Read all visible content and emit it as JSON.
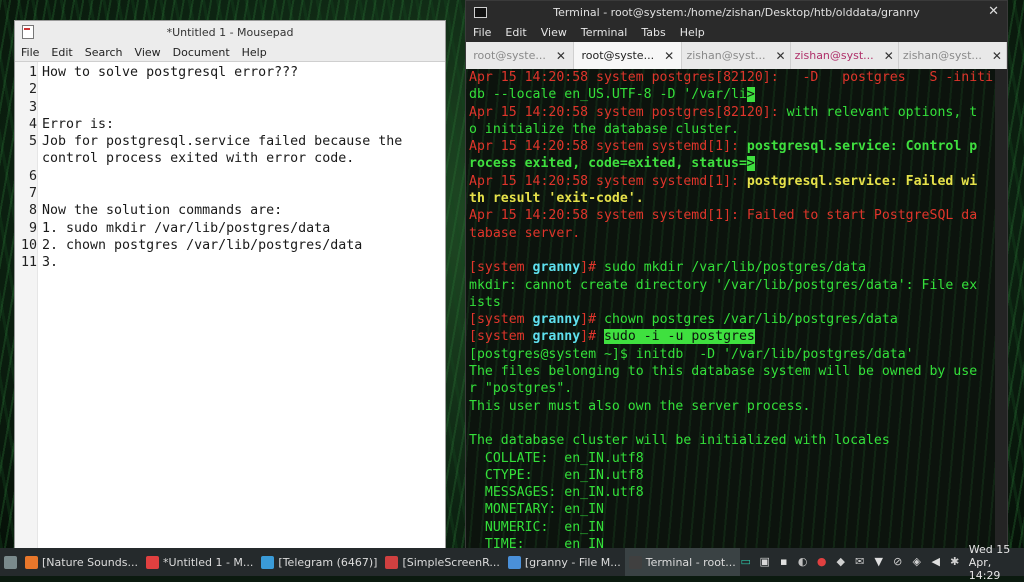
{
  "mousepad": {
    "title": "*Untitled 1 - Mousepad",
    "menu": [
      "File",
      "Edit",
      "Search",
      "View",
      "Document",
      "Help"
    ],
    "lines": [
      {
        "n": "1",
        "t": "How to solve postgresql error???"
      },
      {
        "n": "2",
        "t": ""
      },
      {
        "n": "3",
        "t": ""
      },
      {
        "n": "4",
        "t": "Error is:"
      },
      {
        "n": "5",
        "t": "Job for postgresql.service failed because the"
      },
      {
        "n": "",
        "t": "control process exited with error code."
      },
      {
        "n": "6",
        "t": ""
      },
      {
        "n": "7",
        "t": ""
      },
      {
        "n": "8",
        "t": "Now the solution commands are:"
      },
      {
        "n": "9",
        "t": "1. sudo mkdir /var/lib/postgres/data"
      },
      {
        "n": "10",
        "t": "2. chown postgres /var/lib/postgres/data"
      },
      {
        "n": "11",
        "t": "3."
      }
    ]
  },
  "terminal": {
    "title": "Terminal - root@system:/home/zishan/Desktop/htb/olddata/granny",
    "close": "✕",
    "menu": [
      "File",
      "Edit",
      "View",
      "Terminal",
      "Tabs",
      "Help"
    ],
    "tabs": [
      {
        "label": "root@syste...",
        "state": "normal"
      },
      {
        "label": "root@syste...",
        "state": "active"
      },
      {
        "label": "zishan@syst...",
        "state": "normal"
      },
      {
        "label": "zishan@syst...",
        "state": "alert"
      },
      {
        "label": "zishan@syst...",
        "state": "normal"
      }
    ],
    "tab_close": "✕",
    "lines": [
      [
        {
          "c": "c-red",
          "t": "Apr 15 14:20:58 system postgres[82120]:   -D   postgres   S -initi"
        }
      ],
      [
        {
          "c": "c-green",
          "t": "db --locale en_US.UTF-8 -D '/var/li"
        },
        {
          "c": "curs",
          "t": ">"
        }
      ],
      [
        {
          "c": "c-red",
          "t": "Apr 15 14:20:58 system postgres[82120]: "
        },
        {
          "c": "c-green",
          "t": "with relevant options, t"
        }
      ],
      [
        {
          "c": "c-green",
          "t": "o initialize the database cluster."
        }
      ],
      [
        {
          "c": "c-red",
          "t": "Apr 15 14:20:58 system systemd[1]: "
        },
        {
          "c": "c-bgreen",
          "t": "postgresql.service: Control p"
        }
      ],
      [
        {
          "c": "c-bgreen",
          "t": "rocess exited, code=exited, status="
        },
        {
          "c": "curs",
          "t": ">"
        }
      ],
      [
        {
          "c": "c-red",
          "t": "Apr 15 14:20:58 system systemd[1]: "
        },
        {
          "c": "c-yellow",
          "t": "postgresql.service: Failed wi"
        }
      ],
      [
        {
          "c": "c-yellow",
          "t": "th result 'exit-code'."
        }
      ],
      [
        {
          "c": "c-red",
          "t": "Apr 15 14:20:58 system systemd[1]: "
        },
        {
          "c": "c-red",
          "t": "Failed to start PostgreSQL da"
        }
      ],
      [
        {
          "c": "c-red",
          "t": "tabase server."
        }
      ],
      [
        {
          "c": "c-red",
          "t": ""
        }
      ],
      [
        {
          "c": "c-red",
          "t": "[system "
        },
        {
          "c": "c-cyan",
          "t": "granny"
        },
        {
          "c": "c-red",
          "t": "]# "
        },
        {
          "c": "c-green",
          "t": "sudo mkdir /var/lib/postgres/data"
        }
      ],
      [
        {
          "c": "c-green",
          "t": "mkdir: cannot create directory '/var/lib/postgres/data': File ex"
        }
      ],
      [
        {
          "c": "c-green",
          "t": "ists"
        }
      ],
      [
        {
          "c": "c-red",
          "t": "[system "
        },
        {
          "c": "c-cyan",
          "t": "granny"
        },
        {
          "c": "c-red",
          "t": "]# "
        },
        {
          "c": "c-green",
          "t": "chown postgres /var/lib/postgres/data"
        }
      ],
      [
        {
          "c": "c-red",
          "t": "[system "
        },
        {
          "c": "c-cyan",
          "t": "granny"
        },
        {
          "c": "c-red",
          "t": "]# "
        },
        {
          "c": "sel",
          "t": "sudo -i -u postgres"
        }
      ],
      [
        {
          "c": "c-green",
          "t": "[postgres@system ~]$ initdb  -D '/var/lib/postgres/data'"
        }
      ],
      [
        {
          "c": "c-green",
          "t": "The files belonging to this database system will be owned by use"
        }
      ],
      [
        {
          "c": "c-green",
          "t": "r \"postgres\"."
        }
      ],
      [
        {
          "c": "c-green",
          "t": "This user must also own the server process."
        }
      ],
      [
        {
          "c": "c-green",
          "t": ""
        }
      ],
      [
        {
          "c": "c-green",
          "t": "The database cluster will be initialized with locales"
        }
      ],
      [
        {
          "c": "c-green",
          "t": "  COLLATE:  en_IN.utf8"
        }
      ],
      [
        {
          "c": "c-green",
          "t": "  CTYPE:    en_IN.utf8"
        }
      ],
      [
        {
          "c": "c-green",
          "t": "  MESSAGES: en_IN.utf8"
        }
      ],
      [
        {
          "c": "c-green",
          "t": "  MONETARY: en_IN"
        }
      ],
      [
        {
          "c": "c-green",
          "t": "  NUMERIC:  en_IN"
        }
      ],
      [
        {
          "c": "c-green",
          "t": "  TIME:     en_IN"
        }
      ]
    ]
  },
  "taskbar": {
    "apps": [
      {
        "label": "",
        "icon": "whisker-menu-icon",
        "color": "#7a8a8c",
        "active": false
      },
      {
        "label": "[Nature Sounds...",
        "icon": "firefox-icon",
        "color": "#e8772b",
        "active": false
      },
      {
        "label": "*Untitled 1 - M...",
        "icon": "mousepad-icon",
        "color": "#e04040",
        "active": false
      },
      {
        "label": "[Telegram (6467)]",
        "icon": "telegram-icon",
        "color": "#3a9bd8",
        "active": false
      },
      {
        "label": "[SimpleScreenR...",
        "icon": "screenrecorder-icon",
        "color": "#d04040",
        "active": false
      },
      {
        "label": "[granny - File M...",
        "icon": "file-manager-icon",
        "color": "#4a90d9",
        "active": false
      },
      {
        "label": "Terminal - root...",
        "icon": "terminal-icon",
        "color": "#404040",
        "active": true
      }
    ],
    "tray_icons": [
      "chat-icon",
      "notes-icon",
      "app-icon",
      "stream-icon",
      "camera-icon",
      "notification-icon",
      "mail-icon",
      "wifi-icon",
      "clip-icon",
      "shield-icon",
      "volume-icon",
      "bluetooth-icon"
    ],
    "clock": "Wed 15 Apr, 14:29"
  }
}
